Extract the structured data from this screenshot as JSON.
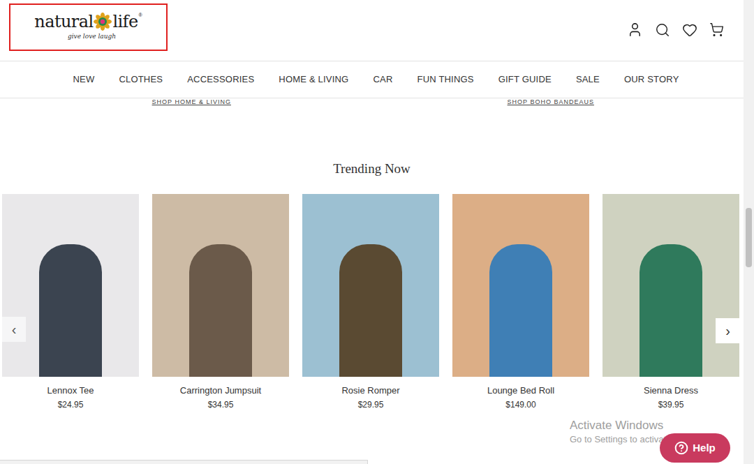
{
  "header": {
    "logo": {
      "left": "natural",
      "right": "life",
      "mark": "®",
      "tagline": "give love laugh",
      "highlighted": true
    }
  },
  "nav": {
    "items": [
      "NEW",
      "CLOTHES",
      "ACCESSORIES",
      "HOME & LIVING",
      "CAR",
      "FUN THINGS",
      "GIFT GUIDE",
      "SALE",
      "OUR STORY"
    ]
  },
  "promo_links": [
    "SHOP HOME & LIVING",
    "SHOP BOHO BANDEAUS"
  ],
  "trending": {
    "title": "Trending Now",
    "prev": "‹",
    "next": "›",
    "products": [
      {
        "name": "Lennox Tee",
        "price": "$24.95"
      },
      {
        "name": "Carrington Jumpsuit",
        "price": "$34.95"
      },
      {
        "name": "Rosie Romper",
        "price": "$29.95"
      },
      {
        "name": "Lounge Bed Roll",
        "price": "$149.00"
      },
      {
        "name": "Sienna Dress",
        "price": "$39.95"
      }
    ]
  },
  "watermark": {
    "title": "Activate Windows",
    "subtitle": "Go to Settings to activate Windows."
  },
  "help_button": {
    "label": "Help"
  }
}
